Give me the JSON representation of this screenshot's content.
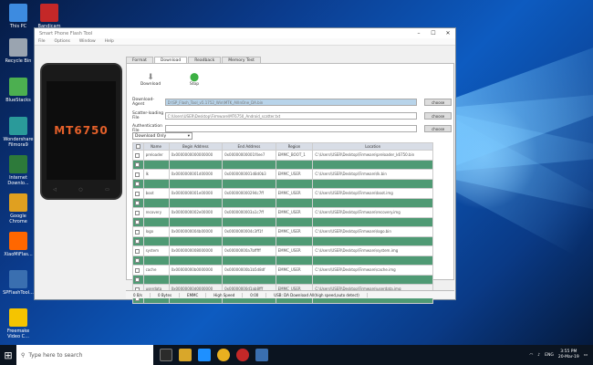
{
  "desktop_icons": [
    {
      "label": "This PC",
      "color": "#3d8be0"
    },
    {
      "label": "Bandicam",
      "color": "#c42828"
    },
    {
      "label": "Recycle Bin",
      "color": "#9aa4b0"
    },
    {
      "label": "BlueStacks",
      "color": "#4caf50"
    },
    {
      "label": "Wondershare Filmora9",
      "color": "#2a9a9a"
    },
    {
      "label": "Internet Downlo...",
      "color": "#2d7a3a"
    },
    {
      "label": "Google Chrome",
      "color": "#e0a020"
    },
    {
      "label": "XiaoMiFlas...",
      "color": "#ff6700"
    },
    {
      "label": "SPFlashTool...",
      "color": "#3a6fb0"
    },
    {
      "label": "Freemake Video C...",
      "color": "#f5c400"
    }
  ],
  "window": {
    "title": "Smart Phone Flash Tool",
    "menu": [
      "File",
      "Options",
      "Window",
      "Help"
    ]
  },
  "phone": {
    "model": "MT6750"
  },
  "tabs": [
    "Format",
    "Download",
    "Readback",
    "Memory Test"
  ],
  "toolbar": {
    "download": "Download",
    "stop": "Stop"
  },
  "fields": [
    {
      "label": "Download-Agent",
      "value": "D:\\SP_Flash_Tool_v5.1752_Win\\MTK_AllInOne_DA.bin",
      "button": "choose"
    },
    {
      "label": "Scatter-loading File",
      "value": "C:\\Users\\USER\\Desktop\\Firmware\\MT6750_Android_scatter.txt",
      "button": "choose"
    },
    {
      "label": "Authentication File",
      "value": "",
      "button": "choose"
    }
  ],
  "mode": "Download Only",
  "table": {
    "headers": [
      "",
      "Name",
      "Begin Address",
      "End Address",
      "Region",
      "Location"
    ],
    "rows": [
      {
        "name": "preloader",
        "begin": "0x0000000000000000",
        "end": "0x00000000001f4ee7",
        "region": "EMMC_BOOT_1",
        "loc": "C:\\Users\\USER\\Desktop\\Firmware\\preloader_k6750.bin"
      },
      {
        "name": "lk",
        "begin": "0x0000000001d00000",
        "end": "0x0000000001d8d0b3",
        "region": "EMMC_USER",
        "loc": "C:\\Users\\USER\\Desktop\\Firmware\\lk.bin"
      },
      {
        "name": "boot",
        "begin": "0x0000000001e00000",
        "end": "0x000000000294c7ff",
        "region": "EMMC_USER",
        "loc": "C:\\Users\\USER\\Desktop\\Firmware\\boot.img"
      },
      {
        "name": "recovery",
        "begin": "0x0000000002e00000",
        "end": "0x0000000003a1c7ff",
        "region": "EMMC_USER",
        "loc": "C:\\Users\\USER\\Desktop\\Firmware\\recovery.img"
      },
      {
        "name": "logo",
        "begin": "0x0000000004b00000",
        "end": "0x0000000004c3ff1f",
        "region": "EMMC_USER",
        "loc": "C:\\Users\\USER\\Desktop\\Firmware\\logo.bin"
      },
      {
        "name": "system",
        "begin": "0x0000000008000000",
        "end": "0x00000000a7bfffff",
        "region": "EMMC_USER",
        "loc": "C:\\Users\\USER\\Desktop\\Firmware\\system.img"
      },
      {
        "name": "cache",
        "begin": "0x00000000b0000000",
        "end": "0x00000000b1b5d8df",
        "region": "EMMC_USER",
        "loc": "C:\\Users\\USER\\Desktop\\Firmware\\cache.img"
      },
      {
        "name": "userdata",
        "begin": "0x00000000d0000000",
        "end": "0x00000000d1ab8fff",
        "region": "EMMC_USER",
        "loc": "C:\\Users\\USER\\Desktop\\Firmware\\userdata.img"
      }
    ]
  },
  "status": [
    "0 B/s",
    "0 Bytes",
    "EMMC",
    "High Speed",
    "0:00",
    "USB: DA Download All(high speed,auto detect)"
  ],
  "taskbar": {
    "search_placeholder": "Type here to search",
    "lang": "ENG",
    "time": "3:55 PM",
    "date": "20-Mar-19"
  }
}
